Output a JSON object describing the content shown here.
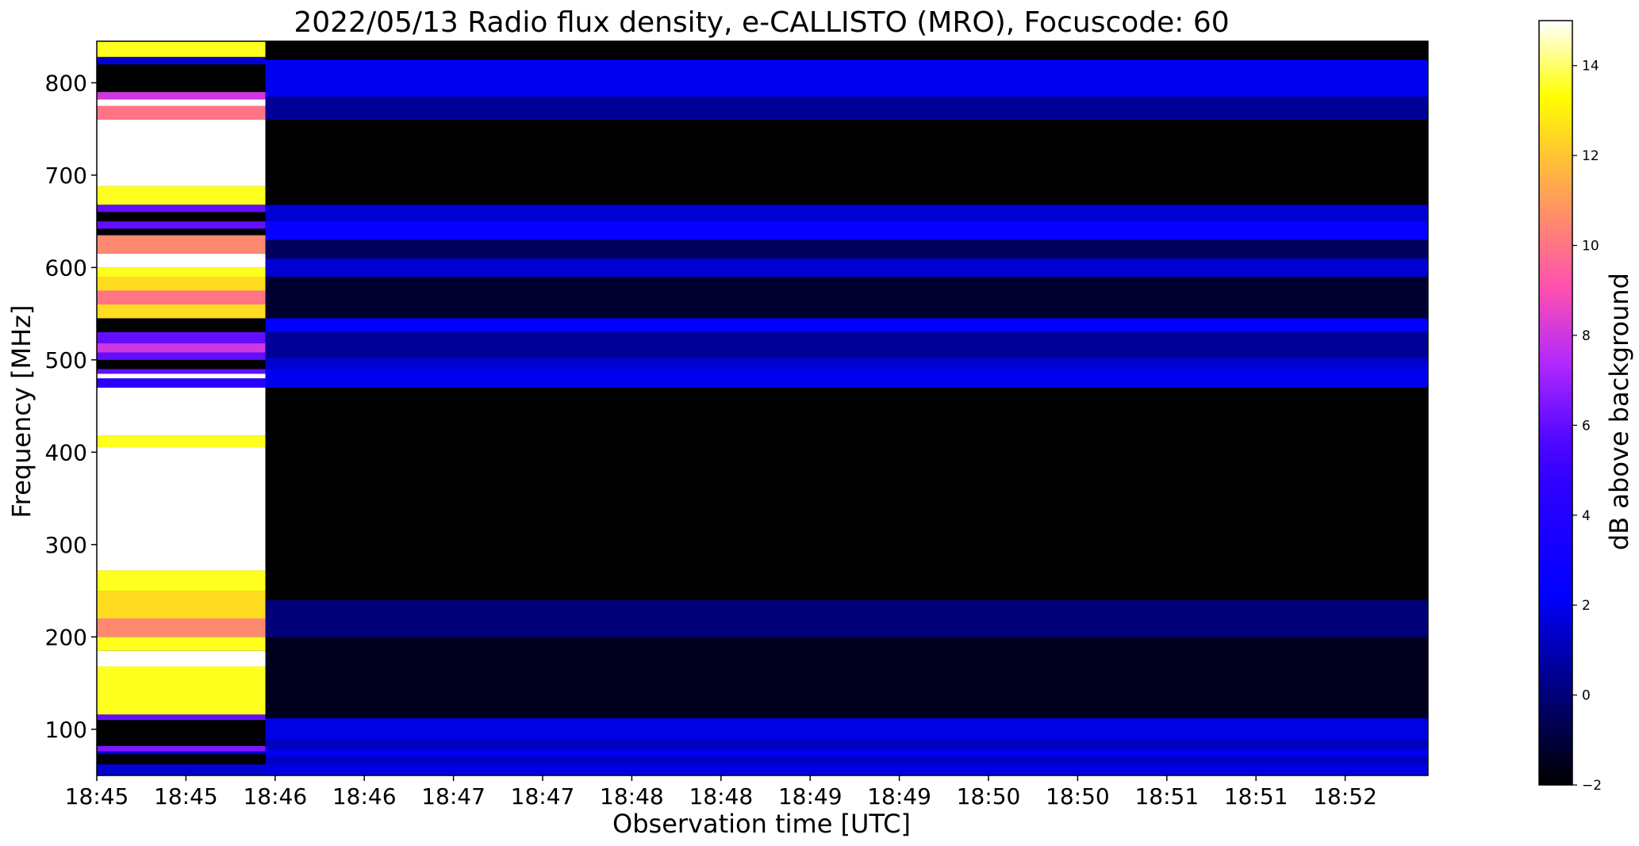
{
  "chart_data": {
    "type": "heatmap",
    "title": "2022/05/13  Radio flux density, e-CALLISTO (MRO), Focuscode: 60",
    "xlabel": "Observation time [UTC]",
    "ylabel": "Frequency [MHz]",
    "colorbar_label": "dB above background",
    "colormap": "gnuplot2",
    "x_tick_labels": [
      "18:45",
      "18:45",
      "18:46",
      "18:46",
      "18:47",
      "18:47",
      "18:48",
      "18:48",
      "18:49",
      "18:49",
      "18:50",
      "18:50",
      "18:51",
      "18:51",
      "18:52"
    ],
    "x_range_seconds": [
      0,
      450
    ],
    "y_ticks": [
      100,
      200,
      300,
      400,
      500,
      600,
      700,
      800
    ],
    "ylim": [
      50,
      845
    ],
    "colorbar_ticks": [
      -2,
      0,
      2,
      4,
      6,
      8,
      10,
      12,
      14
    ],
    "clim": [
      -2,
      15
    ],
    "calibration_segment_end_seconds": 57,
    "calibration_profile": [
      {
        "from": 50,
        "to": 62,
        "value": 1.5
      },
      {
        "from": 62,
        "to": 73,
        "value": -2
      },
      {
        "from": 73,
        "to": 76,
        "value": 1.5
      },
      {
        "from": 76,
        "to": 82,
        "value": 6.5
      },
      {
        "from": 82,
        "to": 96,
        "value": -2
      },
      {
        "from": 96,
        "to": 110,
        "value": -2
      },
      {
        "from": 110,
        "to": 116,
        "value": 6
      },
      {
        "from": 116,
        "to": 168,
        "value": 13.5
      },
      {
        "from": 168,
        "to": 185,
        "value": 15
      },
      {
        "from": 185,
        "to": 200,
        "value": 13.5
      },
      {
        "from": 200,
        "to": 220,
        "value": 10.5
      },
      {
        "from": 220,
        "to": 250,
        "value": 12.5
      },
      {
        "from": 250,
        "to": 272,
        "value": 13.5
      },
      {
        "from": 272,
        "to": 405,
        "value": 15
      },
      {
        "from": 405,
        "to": 418,
        "value": 13.5
      },
      {
        "from": 418,
        "to": 470,
        "value": 15
      },
      {
        "from": 470,
        "to": 480,
        "value": 4.5
      },
      {
        "from": 480,
        "to": 485,
        "value": 15
      },
      {
        "from": 485,
        "to": 490,
        "value": 6
      },
      {
        "from": 490,
        "to": 500,
        "value": -2
      },
      {
        "from": 500,
        "to": 508,
        "value": 6
      },
      {
        "from": 508,
        "to": 518,
        "value": 8
      },
      {
        "from": 518,
        "to": 530,
        "value": 6
      },
      {
        "from": 530,
        "to": 545,
        "value": -2
      },
      {
        "from": 545,
        "to": 560,
        "value": 12.5
      },
      {
        "from": 560,
        "to": 575,
        "value": 10
      },
      {
        "from": 575,
        "to": 590,
        "value": 12.5
      },
      {
        "from": 590,
        "to": 600,
        "value": 13.5
      },
      {
        "from": 600,
        "to": 615,
        "value": 15
      },
      {
        "from": 615,
        "to": 635,
        "value": 10.5
      },
      {
        "from": 635,
        "to": 642,
        "value": -2
      },
      {
        "from": 642,
        "to": 650,
        "value": 6
      },
      {
        "from": 650,
        "to": 660,
        "value": -2
      },
      {
        "from": 660,
        "to": 668,
        "value": 6
      },
      {
        "from": 668,
        "to": 688,
        "value": 13.5
      },
      {
        "from": 688,
        "to": 760,
        "value": 15
      },
      {
        "from": 760,
        "to": 775,
        "value": 10
      },
      {
        "from": 775,
        "to": 782,
        "value": 15
      },
      {
        "from": 782,
        "to": 790,
        "value": 8
      },
      {
        "from": 790,
        "to": 820,
        "value": -2
      },
      {
        "from": 820,
        "to": 828,
        "value": 1.5
      },
      {
        "from": 828,
        "to": 845,
        "value": 13.5
      }
    ],
    "observation_profile": [
      {
        "from": 50,
        "to": 62,
        "value": 1.8
      },
      {
        "from": 62,
        "to": 70,
        "value": 1.2
      },
      {
        "from": 70,
        "to": 78,
        "value": 2
      },
      {
        "from": 78,
        "to": 88,
        "value": 1.2
      },
      {
        "from": 88,
        "to": 112,
        "value": 1.8
      },
      {
        "from": 112,
        "to": 200,
        "value": -1.5
      },
      {
        "from": 200,
        "to": 240,
        "value": 0
      },
      {
        "from": 240,
        "to": 470,
        "value": -2
      },
      {
        "from": 470,
        "to": 490,
        "value": 2
      },
      {
        "from": 490,
        "to": 502,
        "value": 1.5
      },
      {
        "from": 502,
        "to": 530,
        "value": 0.5
      },
      {
        "from": 530,
        "to": 545,
        "value": 2.2
      },
      {
        "from": 545,
        "to": 590,
        "value": -1.2
      },
      {
        "from": 590,
        "to": 610,
        "value": 1.5
      },
      {
        "from": 610,
        "to": 630,
        "value": -0.5
      },
      {
        "from": 630,
        "to": 650,
        "value": 2.5
      },
      {
        "from": 650,
        "to": 668,
        "value": 1.5
      },
      {
        "from": 668,
        "to": 760,
        "value": -2
      },
      {
        "from": 760,
        "to": 785,
        "value": 0.5
      },
      {
        "from": 785,
        "to": 825,
        "value": 2
      },
      {
        "from": 825,
        "to": 845,
        "value": -2
      }
    ]
  }
}
